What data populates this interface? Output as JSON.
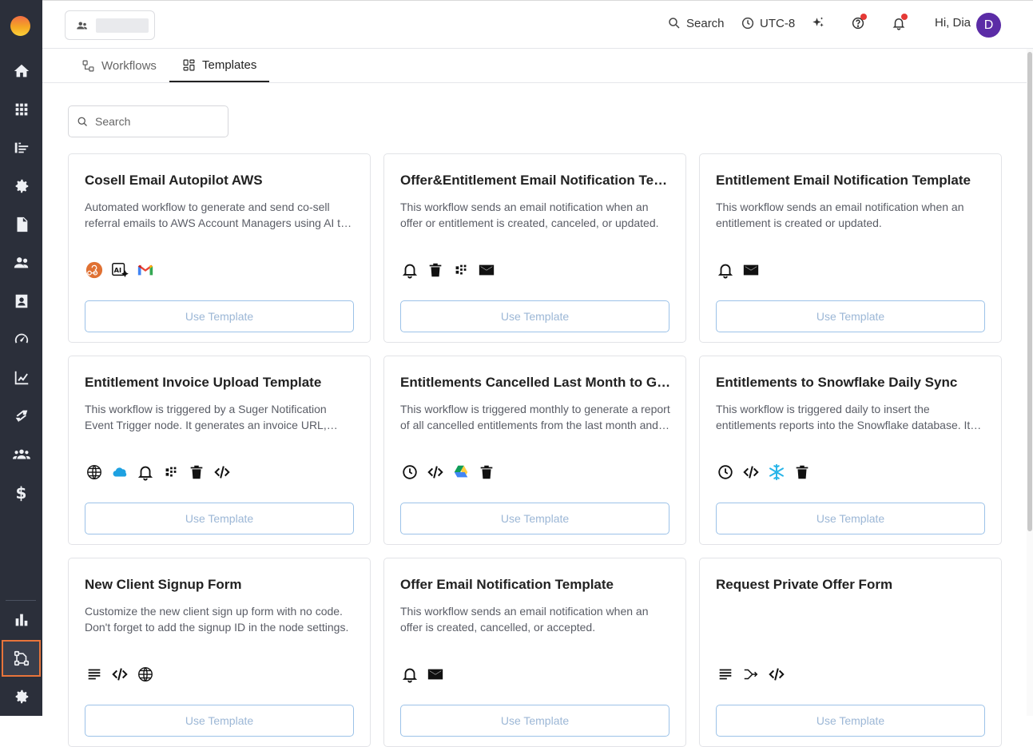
{
  "header": {
    "search_label": "Search",
    "timezone_label": "UTC-8",
    "greeting": "Hi, Dia",
    "avatar_initial": "D"
  },
  "tabs": [
    {
      "label": "Workflows",
      "active": false
    },
    {
      "label": "Templates",
      "active": true
    }
  ],
  "search": {
    "placeholder": "Search"
  },
  "cards": [
    {
      "title": "Cosell Email Autopilot AWS",
      "description": "Automated workflow to generate and send co-sell referral emails to AWS Account Managers using AI to craft personalized messages.",
      "icons": [
        "webhook-icon",
        "ai-icon",
        "gmail-icon"
      ],
      "button": "Use Template"
    },
    {
      "title": "Offer&Entitlement Email Notification Template",
      "description": "This workflow sends an email notification when an offer or entitlement is created, canceled, or updated.",
      "icons": [
        "bell-icon",
        "trash-icon",
        "grid-icon",
        "mail-icon"
      ],
      "button": "Use Template"
    },
    {
      "title": "Entitlement Email Notification Template",
      "description": "This workflow sends an email notification when an entitlement is created or updated.",
      "icons": [
        "bell-icon",
        "mail-icon"
      ],
      "button": "Use Template"
    },
    {
      "title": "Entitlement Invoice Upload Template",
      "description": "This workflow is triggered by a Suger Notification Event Trigger node. It generates an invoice URL, uploads it and updates the entitlement.",
      "icons": [
        "globe-icon",
        "salesforce-icon",
        "bell-icon",
        "grid-icon",
        "trash-icon",
        "code-icon"
      ],
      "button": "Use Template"
    },
    {
      "title": "Entitlements Cancelled Last Month to Google Drive",
      "description": "This workflow is triggered monthly to generate a report of all cancelled entitlements from the last month and upload it.",
      "icons": [
        "clock-icon",
        "code-icon",
        "google-drive-icon",
        "trash-icon"
      ],
      "button": "Use Template"
    },
    {
      "title": "Entitlements to Snowflake Daily Sync",
      "description": "This workflow is triggered daily to insert the entitlements reports into the Snowflake database. It runs every day.",
      "icons": [
        "clock-icon",
        "code-icon",
        "snowflake-icon",
        "trash-icon"
      ],
      "button": "Use Template"
    },
    {
      "title": "New Client Signup Form",
      "description": "Customize the new client sign up form with no code. Don't forget to add the signup ID in the node settings.",
      "icons": [
        "form-icon",
        "code-icon",
        "globe-icon"
      ],
      "button": "Use Template"
    },
    {
      "title": "Offer Email Notification Template",
      "description": "This workflow sends an email notification when an offer is created, cancelled, or accepted.",
      "icons": [
        "bell-icon",
        "mail-icon"
      ],
      "button": "Use Template"
    },
    {
      "title": "Request Private Offer Form",
      "description": "",
      "icons": [
        "form-icon",
        "branch-icon",
        "code-icon"
      ],
      "button": "Use Template"
    }
  ],
  "sidebar": {
    "items": [
      "home-icon",
      "apps-icon",
      "listing-icon",
      "settings-gear-icon",
      "document-icon",
      "users-icon",
      "contacts-icon",
      "speed-icon",
      "analytics-icon",
      "integration-icon",
      "team-icon",
      "billing-icon"
    ],
    "billing_symbol": "$",
    "bottom_items": [
      "bar-chart-icon",
      "workflow-icon",
      "settings-icon"
    ],
    "active": "workflow-icon"
  }
}
